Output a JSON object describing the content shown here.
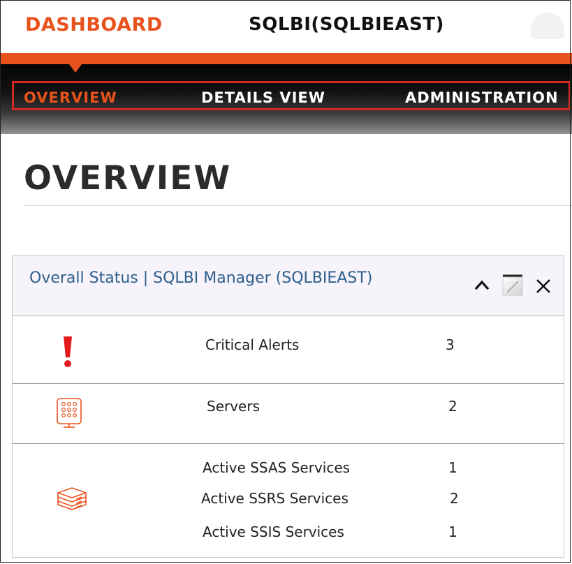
{
  "colors": {
    "accent": "#e8531d",
    "nav_highlight": "#d42a1f",
    "title_link": "#2d5e8c",
    "alert_red": "#e31b1b"
  },
  "header": {
    "brand": "DASHBOARD",
    "server": "SQLBI(SQLBIEAST)"
  },
  "nav": {
    "tabs": [
      {
        "label": "OVERVIEW",
        "active": true
      },
      {
        "label": "DETAILS VIEW",
        "active": false
      },
      {
        "label": "ADMINISTRATION",
        "active": false
      }
    ]
  },
  "page": {
    "title": "OVERVIEW"
  },
  "widget": {
    "title": "Overall Status | SQLBI Manager (SQLBIEAST)",
    "controls": {
      "collapse_icon": "chevron-up-icon",
      "maximize_icon": "maximize-icon",
      "close_icon": "close-icon",
      "collapse_glyph": "⌃",
      "close_glyph": "✕"
    },
    "rows": [
      {
        "icon": "alert-exclamation-icon",
        "glyph": "!",
        "items": [
          {
            "label": "Critical Alerts",
            "value": "3"
          }
        ]
      },
      {
        "icon": "server-icon",
        "items": [
          {
            "label": "Servers",
            "value": "2"
          }
        ]
      },
      {
        "icon": "services-stack-icon",
        "items": [
          {
            "label": "Active SSAS Services",
            "value": "1"
          },
          {
            "label": "Active SSRS Services",
            "value": "2"
          },
          {
            "label": "Active SSIS Services",
            "value": "1"
          }
        ]
      }
    ]
  }
}
